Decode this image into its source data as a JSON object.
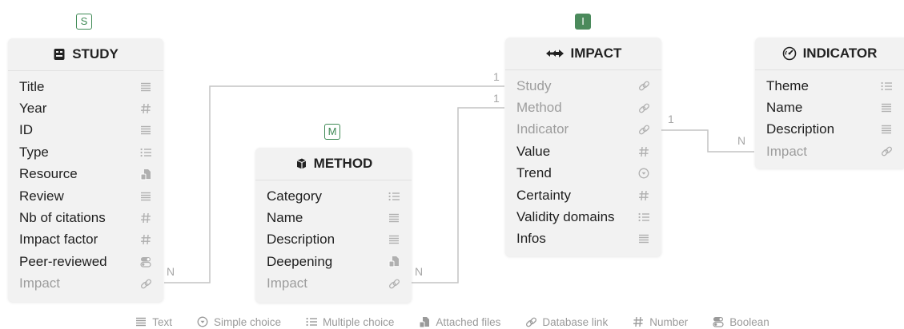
{
  "badges": {
    "study": "S",
    "method": "M",
    "impact": "I"
  },
  "tables": {
    "study": {
      "title": "STUDY",
      "fields": [
        {
          "name": "Title",
          "type": "text"
        },
        {
          "name": "Year",
          "type": "number"
        },
        {
          "name": "ID",
          "type": "text"
        },
        {
          "name": "Type",
          "type": "multiple-choice"
        },
        {
          "name": "Resource",
          "type": "attached-files"
        },
        {
          "name": "Review",
          "type": "text"
        },
        {
          "name": "Nb of citations",
          "type": "number"
        },
        {
          "name": "Impact factor",
          "type": "number"
        },
        {
          "name": "Peer-reviewed",
          "type": "boolean"
        },
        {
          "name": "Impact",
          "type": "database-link"
        }
      ]
    },
    "method": {
      "title": "METHOD",
      "fields": [
        {
          "name": "Category",
          "type": "multiple-choice"
        },
        {
          "name": "Name",
          "type": "text"
        },
        {
          "name": "Description",
          "type": "text"
        },
        {
          "name": "Deepening",
          "type": "attached-files"
        },
        {
          "name": "Impact",
          "type": "database-link"
        }
      ]
    },
    "impact": {
      "title": "IMPACT",
      "fields": [
        {
          "name": "Study",
          "type": "database-link"
        },
        {
          "name": "Method",
          "type": "database-link"
        },
        {
          "name": "Indicator",
          "type": "database-link"
        },
        {
          "name": "Value",
          "type": "number"
        },
        {
          "name": "Trend",
          "type": "simple-choice"
        },
        {
          "name": "Certainty",
          "type": "number"
        },
        {
          "name": "Validity domains",
          "type": "multiple-choice"
        },
        {
          "name": "Infos",
          "type": "text"
        }
      ]
    },
    "indicator": {
      "title": "INDICATOR",
      "fields": [
        {
          "name": "Theme",
          "type": "multiple-choice"
        },
        {
          "name": "Name",
          "type": "text"
        },
        {
          "name": "Description",
          "type": "text"
        },
        {
          "name": "Impact",
          "type": "database-link"
        }
      ]
    }
  },
  "relations": {
    "study_impact": {
      "from": "N",
      "to": "1"
    },
    "method_impact": {
      "from": "N",
      "to": "1"
    },
    "impact_indicator": {
      "from": "1",
      "to": "N"
    }
  },
  "legend": {
    "text": "Text",
    "simple_choice": "Simple choice",
    "multiple_choice": "Multiple choice",
    "attached_files": "Attached files",
    "database_link": "Database link",
    "number": "Number",
    "boolean": "Boolean"
  }
}
